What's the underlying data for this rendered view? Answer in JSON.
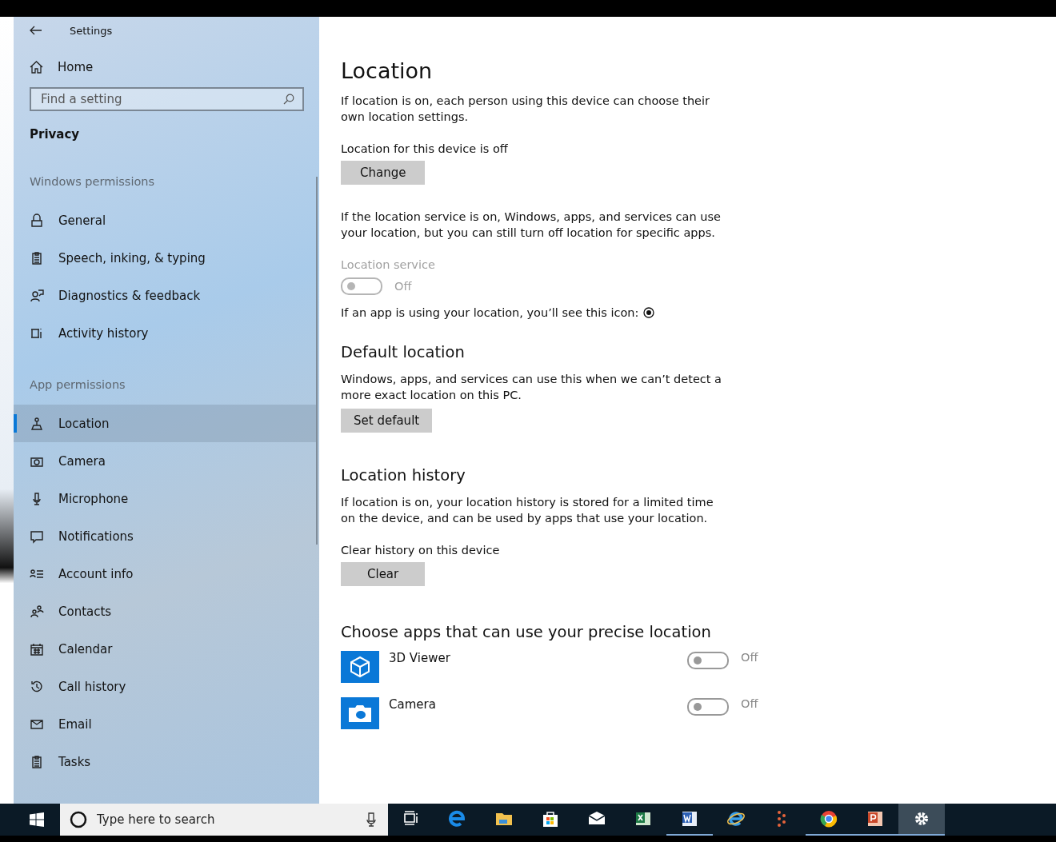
{
  "window": {
    "title": "Settings"
  },
  "sidebar": {
    "home": "Home",
    "search": {
      "placeholder": "Find a setting"
    },
    "section": "Privacy",
    "groups": [
      {
        "heading": "Windows permissions",
        "items": [
          {
            "label": "General",
            "selected": false
          },
          {
            "label": "Speech, inking, & typing",
            "selected": false
          },
          {
            "label": "Diagnostics & feedback",
            "selected": false
          },
          {
            "label": "Activity history",
            "selected": false
          }
        ]
      },
      {
        "heading": "App permissions",
        "items": [
          {
            "label": "Location",
            "selected": true
          },
          {
            "label": "Camera",
            "selected": false
          },
          {
            "label": "Microphone",
            "selected": false
          },
          {
            "label": "Notifications",
            "selected": false
          },
          {
            "label": "Account info",
            "selected": false
          },
          {
            "label": "Contacts",
            "selected": false
          },
          {
            "label": "Calendar",
            "selected": false
          },
          {
            "label": "Call history",
            "selected": false
          },
          {
            "label": "Email",
            "selected": false
          },
          {
            "label": "Tasks",
            "selected": false
          }
        ]
      }
    ]
  },
  "content": {
    "title": "Location",
    "intro": "If location is on, each person using this device can choose their own location settings.",
    "device_status": "Location for this device is off",
    "change_button": "Change",
    "service_note": "If the location service is on, Windows, apps, and services can use your location, but you can still turn off location for specific apps.",
    "service_toggle": {
      "label": "Location service",
      "on": false,
      "disabled": true,
      "state": "Off"
    },
    "icon_note": "If an app is using your location, you’ll see this icon:",
    "default_location": {
      "heading": "Default location",
      "text": "Windows, apps, and services can use this when we can’t detect a more exact location on this PC.",
      "button": "Set default"
    },
    "history": {
      "heading": "Location history",
      "text": "If location is on, your location history is stored for a limited time on the device, and can be used by apps that use your location.",
      "label": "Clear history on this device",
      "button": "Clear"
    },
    "apps": {
      "heading": "Choose apps that can use your precise location",
      "items": [
        {
          "name": "3D Viewer",
          "on": false,
          "state": "Off"
        },
        {
          "name": "Camera",
          "on": false,
          "state": "Off"
        }
      ]
    }
  },
  "taskbar": {
    "search": {
      "placeholder": "Type here to search"
    },
    "apps": [
      {
        "running": false,
        "selected": false
      },
      {
        "running": false,
        "selected": false
      },
      {
        "running": false,
        "selected": false
      },
      {
        "running": false,
        "selected": false
      },
      {
        "running": false,
        "selected": false
      },
      {
        "running": false,
        "selected": false
      },
      {
        "running": true,
        "selected": false
      },
      {
        "running": false,
        "selected": false
      },
      {
        "running": false,
        "selected": false
      },
      {
        "running": true,
        "selected": false
      },
      {
        "running": true,
        "selected": false
      },
      {
        "running": true,
        "selected": true
      }
    ]
  }
}
